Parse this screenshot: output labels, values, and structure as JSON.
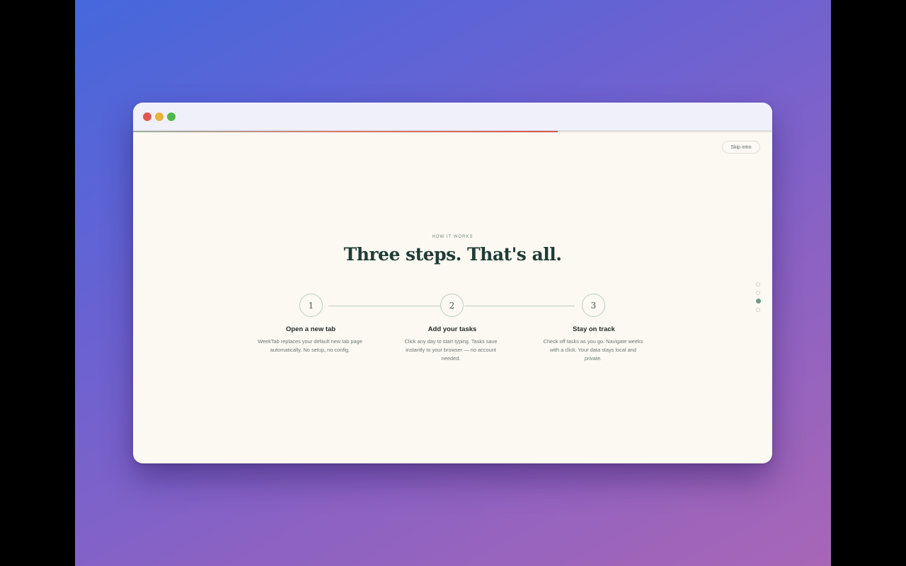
{
  "browser": {
    "traffic_lights": [
      "close",
      "minimize",
      "maximize"
    ]
  },
  "intro": {
    "progress_fraction": 0.665,
    "skip_label": "Skip intro",
    "eyebrow": "HOW IT WORKS",
    "headline": "Three steps. That's all.",
    "steps": [
      {
        "number": "1",
        "title": "Open a new tab",
        "description": "WeekTab replaces your default new tab page automatically. No setup, no config."
      },
      {
        "number": "2",
        "title": "Add your tasks",
        "description": "Click any day to start typing. Tasks save instantly to your browser — no account needed."
      },
      {
        "number": "3",
        "title": "Stay on track",
        "description": "Check off tasks as you go. Navigate weeks with a click. Your data stays local and private."
      }
    ],
    "pagination": {
      "total": 4,
      "current_index": 2
    }
  },
  "colors": {
    "accent_green": "#6c9a84",
    "heading": "#1f3d34",
    "progress_red": "#d65a4e",
    "page_bg": "#fcf8f2"
  }
}
